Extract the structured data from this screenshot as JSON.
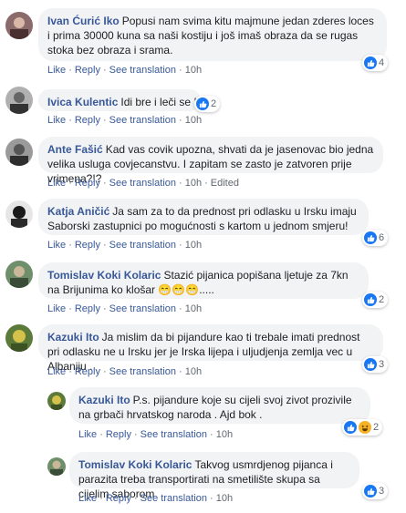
{
  "actions": {
    "like": "Like",
    "reply": "Reply",
    "see_translation": "See translation",
    "edited": "Edited"
  },
  "colors": {
    "link": "#385898",
    "bubble": "#f2f3f5",
    "like_blue": "#1877f2",
    "haha_yellow": "#f7b125"
  },
  "comments": [
    {
      "author": "Ivan Ćurić Iko",
      "text": "Popusi nam svima kitu majmune jedan zderes loces i prima 30000 kuna sa naši kostiju i još imaš obraza da se rugas stoka bez obraza i srama.",
      "time": "10h",
      "reactions": [
        "like"
      ],
      "reaction_count": "4"
    },
    {
      "author": "Ivica Kulentic",
      "text": "Idi bre i leči se !",
      "time": "10h",
      "reactions": [
        "like"
      ],
      "reaction_count": "2"
    },
    {
      "author": "Ante Fašić",
      "text": "Kad vas covik upozna, shvati da je jasenovac bio jedna velika usluga covjecanstvu. I zapitam se zasto je zatvoren prije vrimena?!?",
      "time": "10h",
      "edited": true
    },
    {
      "author": "Katja Aničić",
      "text": "Ja sam za to da prednost pri odlasku u Irsku imaju Saborski zastupnici po mogućnosti s kartom u jednom smjeru!",
      "time": "10h",
      "reactions": [
        "like"
      ],
      "reaction_count": "6"
    },
    {
      "author": "Tomislav Koki Kolaric",
      "text": "Stazić pijanica popišana ljetuje za 7kn na Brijunima ko klošar 😁😁😁.....",
      "time": "10h",
      "reactions": [
        "like"
      ],
      "reaction_count": "2"
    },
    {
      "author": "Kazuki Ito",
      "text": "Ja mislim da bi pijandure kao ti trebale imati prednost pri odlasku ne u Irsku jer je Irska lijepa i uljudjenja zemlja vec u Albaniju .",
      "time": "10h",
      "reactions": [
        "like"
      ],
      "reaction_count": "3"
    }
  ],
  "replies": [
    {
      "author": "Kazuki Ito",
      "text": "P.s. pijandure koje su cijeli svoj zivot prozivile na grbači hrvatskog naroda . Ajd bok .",
      "time": "10h",
      "reactions": [
        "like",
        "haha"
      ],
      "reaction_count": "2"
    },
    {
      "author": "Tomislav Koki Kolaric",
      "text": "Takvog usmrdjenog pijanca i parazita treba transportirati na smetilište skupa sa cijelim saborom",
      "time": "10h",
      "reactions": [
        "like"
      ],
      "reaction_count": "3"
    }
  ]
}
